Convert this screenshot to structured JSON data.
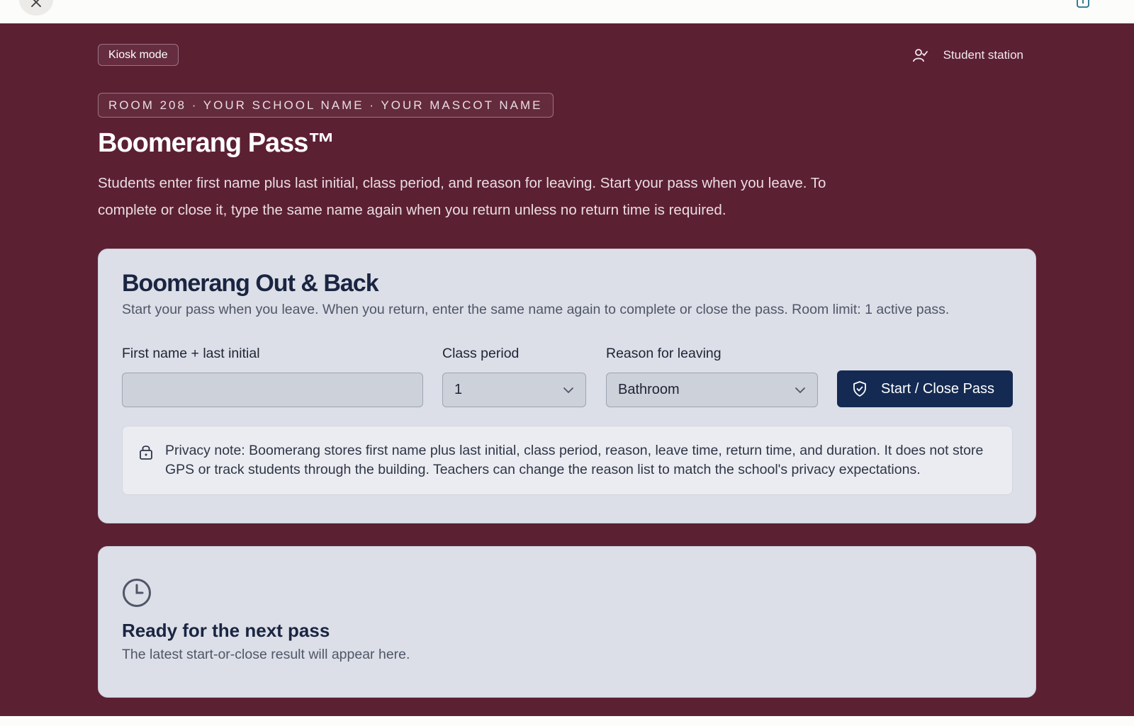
{
  "header": {
    "kiosk_label": "Kiosk mode",
    "station_label": "Student station"
  },
  "hero": {
    "room_line": "ROOM 208 · YOUR SCHOOL NAME · YOUR MASCOT NAME",
    "title": "Boomerang Pass™",
    "description": "Students enter first name plus last initial, class period, and reason for leaving. Start your pass when you leave. To complete or close it, type the same name again when you return unless no return time is required."
  },
  "pass_form": {
    "title": "Boomerang Out & Back",
    "subtitle": "Start your pass when you leave. When you return, enter the same name again to complete or close the pass. Room limit: 1 active pass.",
    "name_label": "First name + last initial",
    "name_value": "",
    "period_label": "Class period",
    "period_value": "1",
    "reason_label": "Reason for leaving",
    "reason_value": "Bathroom",
    "submit_label": "Start / Close Pass",
    "privacy_note": "Privacy note: Boomerang stores first name plus last initial, class period, reason, leave time, return time, and duration. It does not store GPS or track students through the building. Teachers can change the reason list to match the school's privacy expectations."
  },
  "result": {
    "title": "Ready for the next pass",
    "subtitle": "The latest start-or-close result will appear here."
  },
  "colors": {
    "background": "#5c2033",
    "card": "#dcdfe7",
    "primary_button": "#142a52"
  },
  "icons": [
    "close-icon",
    "share-icon",
    "user-check-icon",
    "shield-check-icon",
    "chevron-down-icon",
    "lock-icon",
    "clock-icon"
  ]
}
